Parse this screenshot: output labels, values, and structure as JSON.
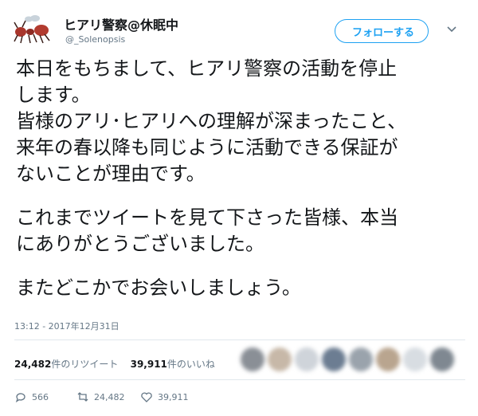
{
  "user": {
    "display_name": "ヒアリ警察@休眠中",
    "handle": "@_Solenopsis"
  },
  "follow_button": {
    "label": "フォローする"
  },
  "tweet": {
    "paragraphs": [
      [
        "本日をもちまして、ヒアリ警察の活動を停止",
        "します。",
        "皆様のアリ･ヒアリへの理解が深まったこと、",
        "来年の春以降も同じように活動できる保証が",
        "ないことが理由です。"
      ],
      [
        "これまでツイートを見て下さった皆様、本当",
        "にありがとうございました。"
      ],
      [
        "またどこかでお会いしましょう。"
      ]
    ],
    "timestamp": "13:12 - 2017年12月31日"
  },
  "stats": {
    "retweet_count": "24,482",
    "retweet_label": "件のリツイート",
    "like_count": "39,911",
    "like_label": "件のいいね"
  },
  "actions": {
    "reply_count": "566",
    "retweet_count": "24,482",
    "like_count": "39,911"
  },
  "colors": {
    "accent": "#1da1f2",
    "secondary_text": "#657786",
    "divider": "#e1e8ed"
  },
  "icons": {
    "avatar": "fire-ant-avatar",
    "menu": "chevron-down-icon",
    "reply": "reply-icon",
    "retweet": "retweet-icon",
    "like": "heart-icon"
  }
}
